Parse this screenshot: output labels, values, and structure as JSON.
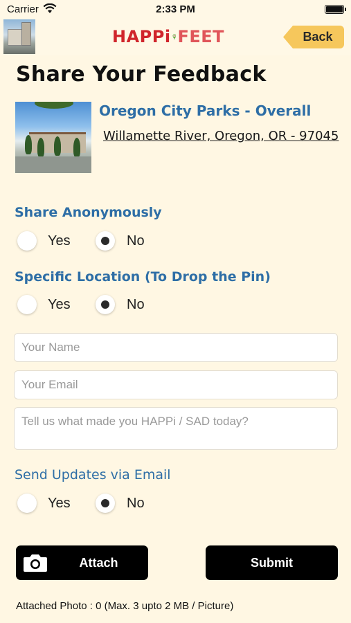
{
  "status_bar": {
    "carrier": "Carrier",
    "time": "2:33 PM"
  },
  "header": {
    "logo_part1": "HAPPi",
    "logo_part2": "FEET",
    "back_label": "Back"
  },
  "page_title": "Share Your Feedback",
  "park": {
    "name": "Oregon City Parks - Overall",
    "address": "Willamette River, Oregon, OR - 97045"
  },
  "share_anonymously": {
    "label": "Share Anonymously",
    "options": [
      "Yes",
      "No"
    ],
    "selected": "No"
  },
  "specific_location": {
    "label": "Specific Location (To Drop the Pin)",
    "options": [
      "Yes",
      "No"
    ],
    "selected": "No"
  },
  "form": {
    "name_placeholder": "Your Name",
    "email_placeholder": "Your Email",
    "feedback_placeholder": "Tell us what made you HAPPi / SAD today?"
  },
  "send_updates": {
    "label": "Send Updates via Email",
    "options": [
      "Yes",
      "No"
    ],
    "selected": "No"
  },
  "buttons": {
    "attach_label": "Attach",
    "submit_label": "Submit"
  },
  "footer": {
    "attached_photo": "Attached Photo : 0 (Max. 3 upto 2 MB / Picture)"
  },
  "colors": {
    "background": "#fff7e3",
    "accent_blue": "#2e6ea6",
    "logo_red": "#d0252b",
    "back_button": "#f6c75c",
    "button_black": "#000000"
  },
  "icons": [
    "wifi-icon",
    "battery-icon",
    "map-pin-check-icon",
    "camera-icon"
  ]
}
